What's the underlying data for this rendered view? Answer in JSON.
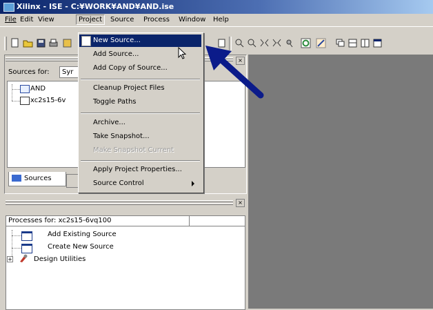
{
  "window": {
    "title": "Xilinx - ISE - C:¥WORK¥AND¥AND.ise"
  },
  "menubar": {
    "items": [
      "File",
      "Edit",
      "View",
      "Project",
      "Source",
      "Process",
      "Window",
      "Help"
    ]
  },
  "project_menu": {
    "items": [
      {
        "label": "New Source...",
        "selected": true
      },
      {
        "label": "Add Source..."
      },
      {
        "label": "Add Copy of Source..."
      },
      {
        "label": "Cleanup Project Files"
      },
      {
        "label": "Toggle Paths"
      },
      {
        "label": "Archive..."
      },
      {
        "label": "Take Snapshot..."
      },
      {
        "label": "Make Snapshot Current",
        "disabled": true
      },
      {
        "label": "Apply Project Properties..."
      },
      {
        "label": "Source Control",
        "submenu": true
      }
    ]
  },
  "sources": {
    "label": "Sources for:",
    "dropdown_value": "Syr",
    "tree": [
      {
        "label": "AND"
      },
      {
        "label": "xc2s15-6v"
      }
    ],
    "tab_label": "Sources"
  },
  "processes": {
    "header": "Processes for: xc2s15-6vq100",
    "items": [
      {
        "label": "Add Existing Source"
      },
      {
        "label": "Create New Source"
      },
      {
        "label": "Design Utilities"
      }
    ]
  },
  "colors": {
    "title_bar": "#0a246a",
    "selection": "#0a246a",
    "annotation_arrow": "#0b1b8a",
    "workspace": "#7a7a7a"
  }
}
